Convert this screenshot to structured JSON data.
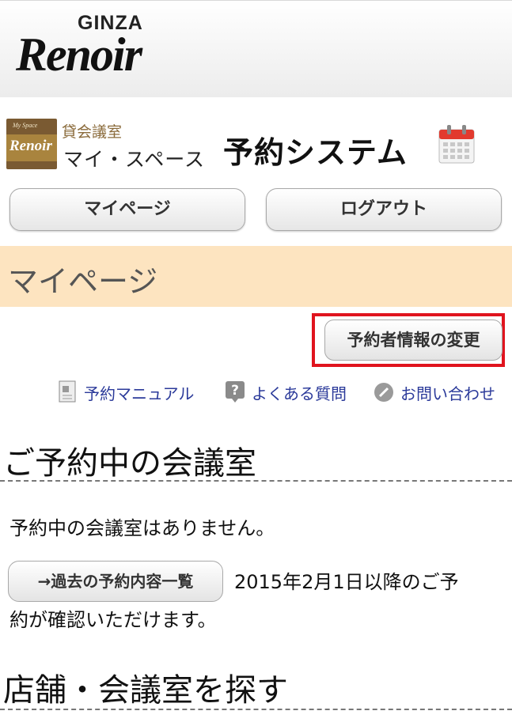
{
  "header": {
    "logo_top": "GINZA",
    "logo_script": "Renoir"
  },
  "brand": {
    "icon_small": "My Space",
    "icon_name": "Renoir",
    "sub": "貸会議室",
    "main": "マイ・スペース",
    "system_title": "予約システム"
  },
  "nav": {
    "mypage_label": "マイページ",
    "logout_label": "ログアウト"
  },
  "page_title": "マイページ",
  "edit_button": "予約者情報の変更",
  "links": {
    "manual": "予約マニュアル",
    "faq": "よくある質問",
    "contact": "お問い合わせ"
  },
  "reservations": {
    "title": "ご予約中の会議室",
    "empty_message": "予約中の会議室はありません。",
    "past_button": "→過去の予約内容一覧",
    "note_line1": "2015年2月1日以降のご予",
    "note_line2": "約が確認いただけます。"
  },
  "search": {
    "title": "店舗・会議室を探す"
  }
}
